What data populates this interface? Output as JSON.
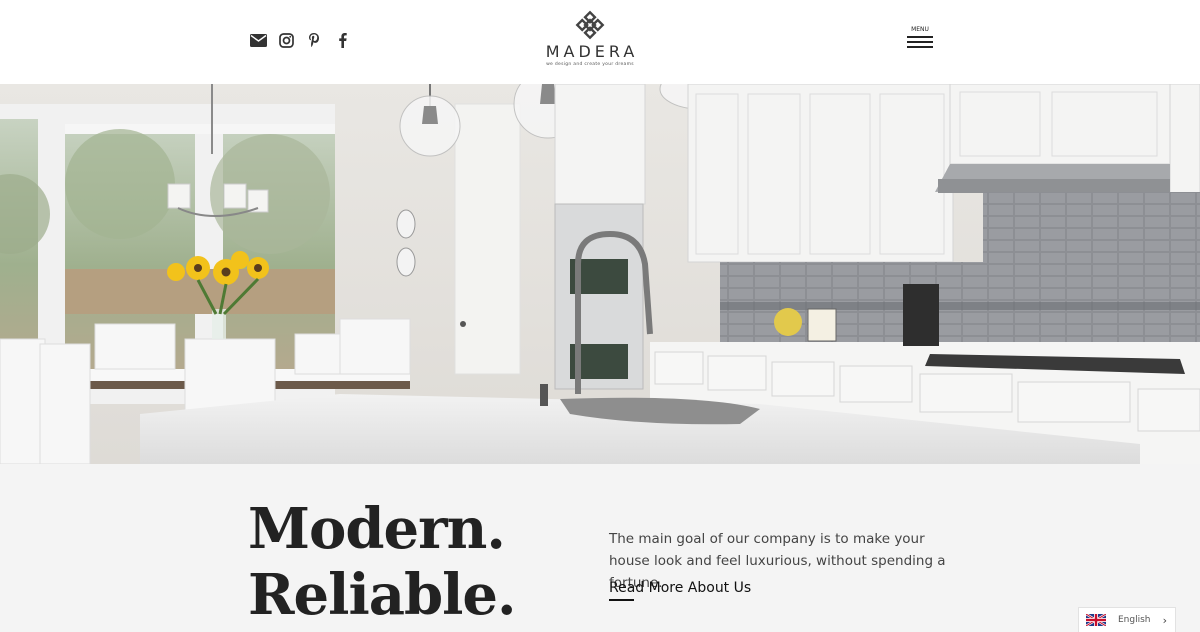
{
  "header": {
    "social_icons": [
      "envelope-icon",
      "instagram-icon",
      "pinterest-icon",
      "facebook-icon"
    ],
    "logo": {
      "name": "MADERA",
      "tagline": "we design and create your dreams"
    },
    "menu_label": "MENU"
  },
  "hero": {
    "image": "white kitchen interior with island and dining area"
  },
  "content": {
    "headline_line1": "Modern.",
    "headline_line2": "Reliable.",
    "description": "The main goal of our company is to make your house look and feel luxurious, without spending a fortune.",
    "read_more_label": "Read More About Us"
  },
  "language": {
    "label": "English",
    "chevron": "›"
  },
  "colors": {
    "text": "#222222",
    "background": "#f4f4f4",
    "header_bg": "#ffffff"
  }
}
